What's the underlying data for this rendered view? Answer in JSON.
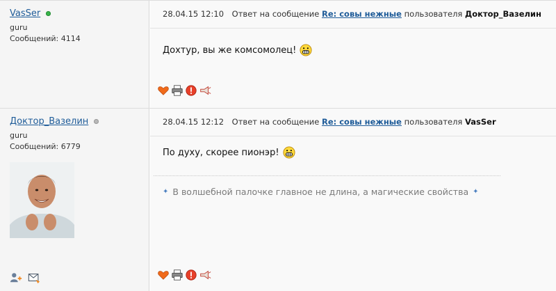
{
  "header_reply_prefix": "Ответ на сообщение",
  "header_user_prefix": "пользователя",
  "posts": [
    {
      "username": "VasSer",
      "status": "online",
      "rank": "guru",
      "messages": "Сообщений: 4114",
      "date": "28.04.15 12:10",
      "reply_to_title": "Re: совы нежные",
      "reply_to_user": "Доктор_Вазелин",
      "text": "Дохтур, вы же комсомолец!",
      "signature": ""
    },
    {
      "username": "Доктор_Вазелин",
      "status": "offline",
      "rank": "guru",
      "messages": "Сообщений: 6779",
      "date": "28.04.15 12:12",
      "reply_to_title": "Re: совы нежные",
      "reply_to_user": "VasSer",
      "text": "По духу, скорее пионэр!",
      "signature": "В волшебной палочке главное не длина, а магические свойства"
    }
  ],
  "icons": {
    "like": "heart-icon",
    "print": "printer-icon",
    "report": "warning-icon",
    "quote": "megaphone-icon",
    "add_friend": "add-friend-icon",
    "message": "envelope-icon",
    "smiley": "grin-smiley-icon"
  },
  "colors": {
    "link": "#1f5c99",
    "online": "#39b54a",
    "offline": "#b8b8b8",
    "sidebar_bg": "#f5f5f5",
    "content_bg": "#f9f9f9"
  }
}
